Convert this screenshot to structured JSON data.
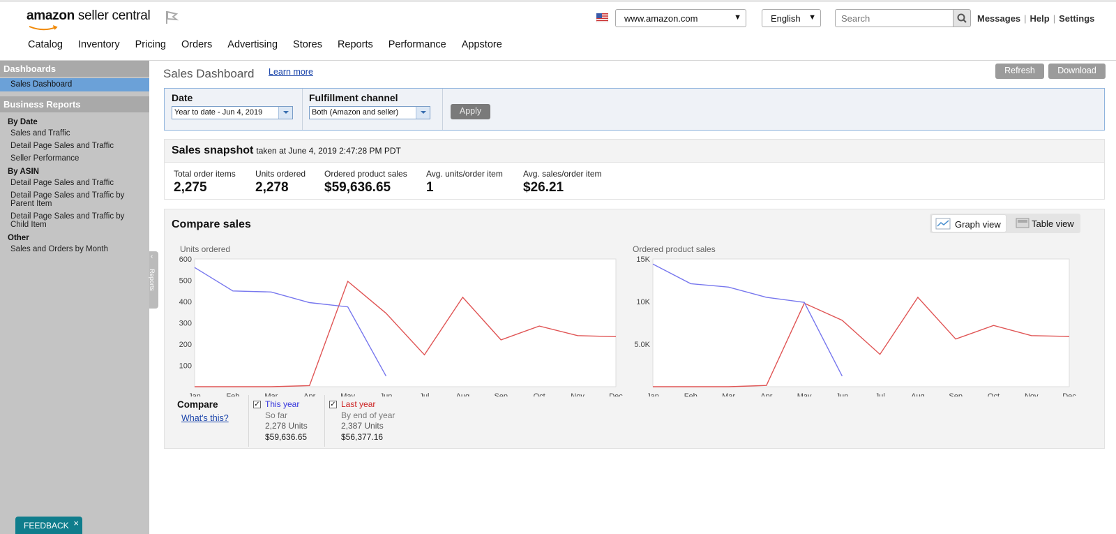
{
  "header": {
    "logo_text_bold": "amazon",
    "logo_text": " seller central",
    "marketplace": "www.amazon.com",
    "language": "English",
    "search_placeholder": "Search",
    "links": [
      "Messages",
      "Help",
      "Settings"
    ]
  },
  "nav": [
    "Catalog",
    "Inventory",
    "Pricing",
    "Orders",
    "Advertising",
    "Stores",
    "Reports",
    "Performance",
    "Appstore"
  ],
  "sidebar": {
    "dashboards_heading": "Dashboards",
    "active_item": "Sales Dashboard",
    "business_reports_heading": "Business Reports",
    "by_date_heading": "By Date",
    "by_date_items": [
      "Sales and Traffic",
      "Detail Page Sales and Traffic",
      "Seller Performance"
    ],
    "by_asin_heading": "By ASIN",
    "by_asin_items": [
      "Detail Page Sales and Traffic",
      "Detail Page Sales and Traffic by Parent Item",
      "Detail Page Sales and Traffic by Child Item"
    ],
    "other_heading": "Other",
    "other_items": [
      "Sales and Orders by Month"
    ],
    "reports_tab": "Reports"
  },
  "feedback_label": "FEEDBACK",
  "page": {
    "title": "Sales Dashboard",
    "learn_more": "Learn more",
    "refresh_button": "Refresh",
    "download_button": "Download"
  },
  "filters": {
    "date_label": "Date",
    "date_value": "Year to date - Jun 4, 2019",
    "channel_label": "Fulfillment channel",
    "channel_value": "Both (Amazon and seller)",
    "apply_button": "Apply"
  },
  "snapshot": {
    "title": "Sales snapshot",
    "subtitle": "taken at June 4, 2019 2:47:28 PM PDT",
    "metrics": [
      {
        "label": "Total order items",
        "value": "2,275"
      },
      {
        "label": "Units ordered",
        "value": "2,278"
      },
      {
        "label": "Ordered product sales",
        "value": "$59,636.65"
      },
      {
        "label": "Avg. units/order item",
        "value": "1"
      },
      {
        "label": "Avg. sales/order item",
        "value": "$26.21"
      }
    ]
  },
  "compare": {
    "title": "Compare sales",
    "graph_view": "Graph view",
    "table_view": "Table view",
    "legend_heading": "Compare",
    "whats_this": "What's this?",
    "this_year": {
      "label": "This year",
      "sub": "So far",
      "units": "2,278 Units",
      "sales": "$59,636.65"
    },
    "last_year": {
      "label": "Last year",
      "sub": "By end of year",
      "units": "2,387 Units",
      "sales": "$56,377.16"
    }
  },
  "colors": {
    "this_year": "#7777ee",
    "last_year": "#e05555",
    "sidebar_active": "#6ba1d8",
    "feedback": "#0f7d8c"
  },
  "chart_data": [
    {
      "type": "line",
      "title": "Units ordered",
      "x": [
        "Jan",
        "Feb",
        "Mar",
        "Apr",
        "May",
        "Jun",
        "Jul",
        "Aug",
        "Sep",
        "Oct",
        "Nov",
        "Dec"
      ],
      "y_ticks": [
        "100",
        "200",
        "300",
        "400",
        "500",
        "600"
      ],
      "ylim": [
        0,
        600
      ],
      "series": [
        {
          "name": "This year",
          "values": [
            560,
            450,
            445,
            395,
            375,
            50
          ]
        },
        {
          "name": "Last year",
          "values": [
            0,
            0,
            0,
            5,
            495,
            345,
            150,
            420,
            220,
            285,
            240,
            235
          ]
        }
      ]
    },
    {
      "type": "line",
      "title": "Ordered product sales",
      "x": [
        "Jan",
        "Feb",
        "Mar",
        "Apr",
        "May",
        "Jun",
        "Jul",
        "Aug",
        "Sep",
        "Oct",
        "Nov",
        "Dec"
      ],
      "y_ticks": [
        "5.0K",
        "10K",
        "15K"
      ],
      "y_tick_values": [
        5000,
        10000,
        15000
      ],
      "ylim": [
        0,
        15000
      ],
      "series": [
        {
          "name": "This year",
          "values": [
            14400,
            12100,
            11700,
            10500,
            9900,
            1250
          ]
        },
        {
          "name": "Last year",
          "values": [
            0,
            0,
            0,
            150,
            9800,
            7800,
            3800,
            10500,
            5600,
            7200,
            6000,
            5900
          ]
        }
      ]
    }
  ]
}
